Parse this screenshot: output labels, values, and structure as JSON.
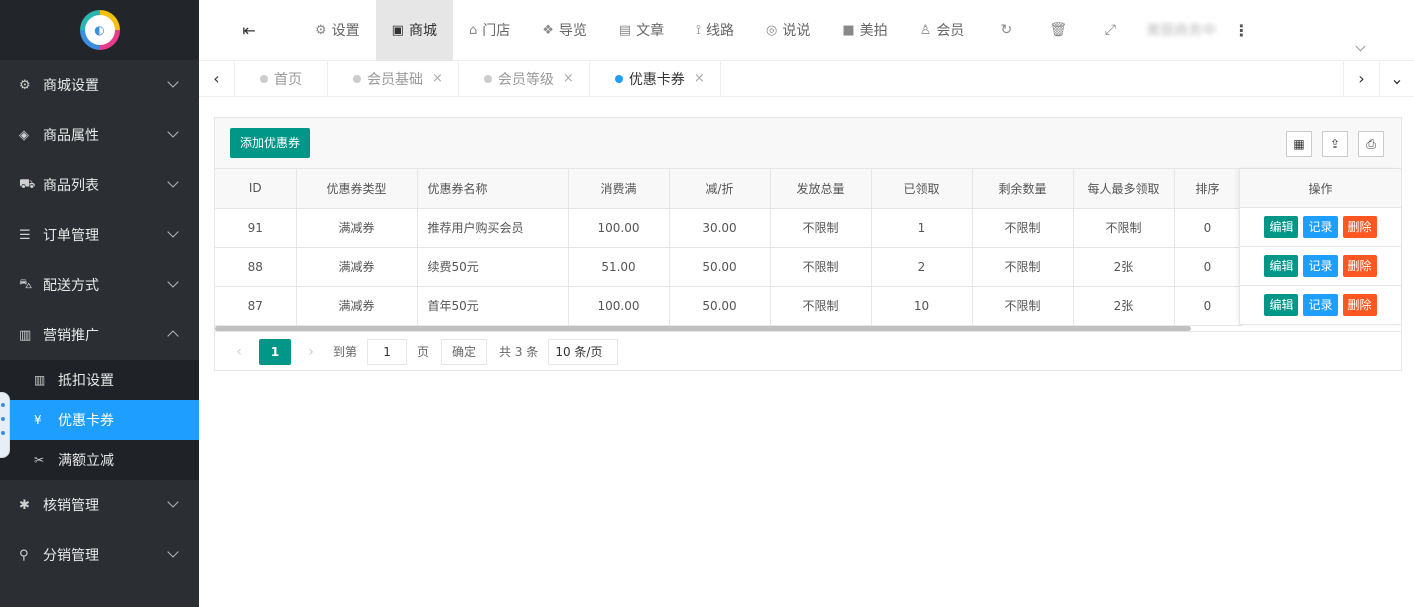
{
  "sidebar": {
    "menu": [
      {
        "icon": "gears-icon",
        "glyph": "⚙",
        "label": "商城设置"
      },
      {
        "icon": "cube-icon",
        "glyph": "◈",
        "label": "商品属性"
      },
      {
        "icon": "cart-icon",
        "glyph": "⛟",
        "label": "商品列表"
      },
      {
        "icon": "list-icon",
        "glyph": "☰",
        "label": "订单管理"
      },
      {
        "icon": "car-icon",
        "glyph": "⛍",
        "label": "配送方式"
      },
      {
        "icon": "chart-icon",
        "glyph": "▥",
        "label": "营销推广"
      }
    ],
    "submenu": [
      {
        "icon": "chart-icon",
        "glyph": "▥",
        "label": "抵扣设置"
      },
      {
        "icon": "yen-icon",
        "glyph": "¥",
        "label": "优惠卡券"
      },
      {
        "icon": "scissors-icon",
        "glyph": "✂",
        "label": "满额立减"
      }
    ],
    "menu_after": [
      {
        "icon": "asterisk-icon",
        "glyph": "✱",
        "label": "核销管理"
      },
      {
        "icon": "sitemap-icon",
        "glyph": "⚲",
        "label": "分销管理"
      }
    ]
  },
  "topnav": {
    "items": [
      {
        "icon": "gears-icon",
        "glyph": "⚙",
        "label": "设置"
      },
      {
        "icon": "bag-icon",
        "glyph": "▣",
        "label": "商城"
      },
      {
        "icon": "bank-icon",
        "glyph": "⌂",
        "label": "门店"
      },
      {
        "icon": "cubes-icon",
        "glyph": "❖",
        "label": "导览"
      },
      {
        "icon": "newspaper-icon",
        "glyph": "▤",
        "label": "文章"
      },
      {
        "icon": "road-icon",
        "glyph": "⟟",
        "label": "线路"
      },
      {
        "icon": "wechat-icon",
        "glyph": "◎",
        "label": "说说"
      },
      {
        "icon": "video-icon",
        "glyph": "■",
        "label": "美拍"
      },
      {
        "icon": "user-icon",
        "glyph": "♙",
        "label": "会员"
      }
    ],
    "user_label": "美丽商务中"
  },
  "tabs": [
    {
      "label": "首页",
      "closable": false
    },
    {
      "label": "会员基础",
      "closable": true
    },
    {
      "label": "会员等级",
      "closable": true
    },
    {
      "label": "优惠卡券",
      "closable": true
    }
  ],
  "toolbar": {
    "add_label": "添加优惠券"
  },
  "table": {
    "columns": [
      "ID",
      "优惠券类型",
      "优惠券名称",
      "消费满",
      "减/折",
      "发放总量",
      "已领取",
      "剩余数量",
      "每人最多领取",
      "排序"
    ],
    "ops_header": "操作",
    "rows": [
      [
        "91",
        "满减券",
        "推荐用户购买会员",
        "100.00",
        "30.00",
        "不限制",
        "1",
        "不限制",
        "不限制",
        "0"
      ],
      [
        "88",
        "满减券",
        "续费50元",
        "51.00",
        "50.00",
        "不限制",
        "2",
        "不限制",
        "2张",
        "0"
      ],
      [
        "87",
        "满减券",
        "首年50元",
        "100.00",
        "50.00",
        "不限制",
        "10",
        "不限制",
        "2张",
        "0"
      ]
    ],
    "ops": {
      "edit": "编辑",
      "record": "记录",
      "delete": "删除"
    }
  },
  "pager": {
    "current": "1",
    "goto_label": "到第",
    "goto_value": "1",
    "page_label": "页",
    "confirm_label": "确定",
    "total_label": "共 3 条",
    "size_label": "10 条/页"
  }
}
